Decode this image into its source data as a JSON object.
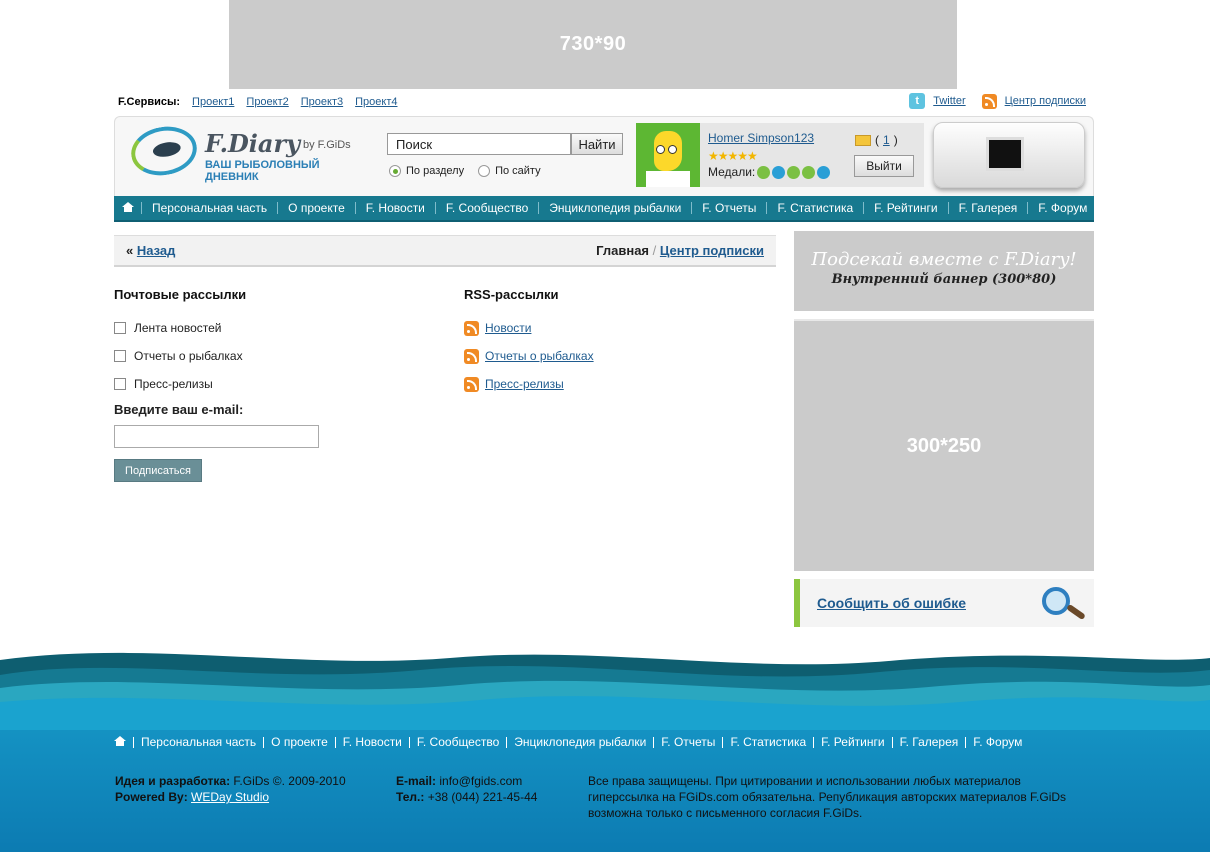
{
  "ad_top": {
    "label": "730*90"
  },
  "services": {
    "label": "F.Сервисы:",
    "links": [
      "Проект1",
      "Проект2",
      "Проект3",
      "Проект4"
    ]
  },
  "top_right": {
    "twitter": "Twitter",
    "rss": "Центр подписки"
  },
  "logo": {
    "name": "F.Diary",
    "by": "by F.GiDs",
    "tagline": "ВАШ РЫБОЛОВНЫЙ ДНЕВНИК"
  },
  "search": {
    "value": "Поиск",
    "button": "Найти",
    "option_section": "По разделу",
    "option_site": "По сайту"
  },
  "user": {
    "name": "Homer Simpson123",
    "stars": "★★★★★",
    "medals_label": "Медали:",
    "messages_count": "1",
    "logout": "Выйти"
  },
  "nav": {
    "items": [
      "Персональная часть",
      "О проекте",
      "F. Новости",
      "F. Сообщество",
      "Энциклопедия рыбалки",
      "F. Отчеты",
      "F. Статистика",
      "F. Рейтинги",
      "F. Галерея",
      "F. Форум"
    ]
  },
  "breadcrumb": {
    "back_prefix": "«",
    "back": "Назад",
    "home": "Главная",
    "sep": "/",
    "current": "Центр подписки"
  },
  "mail": {
    "title": "Почтовые рассылки",
    "items": [
      "Лента новостей",
      "Отчеты о рыбалках",
      "Пресс-релизы"
    ],
    "email_label": "Введите ваш e-mail:",
    "email_value": "",
    "submit": "Подписаться"
  },
  "rss": {
    "title": "RSS-рассылки",
    "items": [
      "Новости",
      "Отчеты о рыбалках",
      "Пресс-релизы"
    ]
  },
  "sidebar": {
    "banner1_line1": "Подсекай вместе с F.Diary!",
    "banner1_line2": "Внутренний баннер (300*80)",
    "banner2": "300*250",
    "report": "Сообщить об ошибке"
  },
  "footer": {
    "nav": [
      "Персональная часть",
      "О проекте",
      "F. Новости",
      "F. Сообщество",
      "Энциклопедия рыбалки",
      "F. Отчеты",
      "F. Статистика",
      "F. Рейтинги",
      "F. Галерея",
      "F. Форум"
    ],
    "dev_label": "Идея и разработка:",
    "dev_value": "F.GiDs ©. 2009-2010",
    "powered_label": "Powered By:",
    "powered_value": "WEDay Studio",
    "email_label": "E-mail:",
    "email_value": "info@fgids.com",
    "phone_label": "Тел.:",
    "phone_value": "+38 (044) 221-45-44",
    "rights": "Все права защищены. При цитировании и использовании любых материалов гиперссылка на FGiDs.com обязательна. Републикация авторских материалов F.GiDs возможна только с письменного согласия F.GiDs."
  },
  "colors": {
    "nav_bg": "#17798f",
    "link": "#1f5b8f",
    "accent_green": "#8cc63f",
    "placeholder_gray": "#cbcbcb"
  }
}
